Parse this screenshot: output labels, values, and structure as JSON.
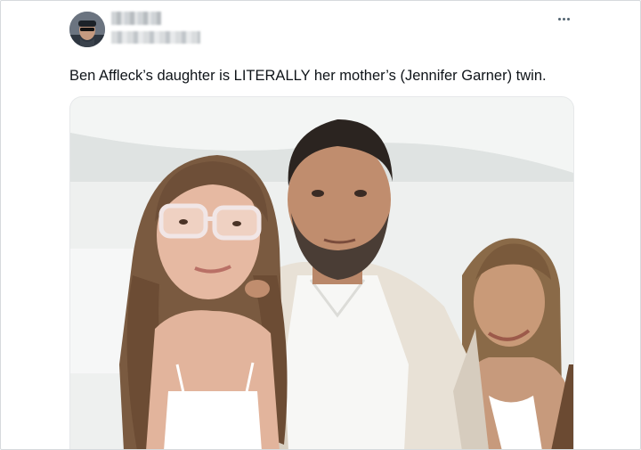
{
  "tweet": {
    "text": "Ben Affleck’s daughter is LITERALLY her mother’s (Jennifer Garner) twin.",
    "author_name_blurred": true,
    "author_handle_blurred": true,
    "more_icon": "more-horizontal-icon"
  },
  "media": {
    "type": "photo",
    "icon": "photo"
  },
  "colors": {
    "text": "#0f1419",
    "secondary": "#536471",
    "border": "#d6dadd"
  }
}
